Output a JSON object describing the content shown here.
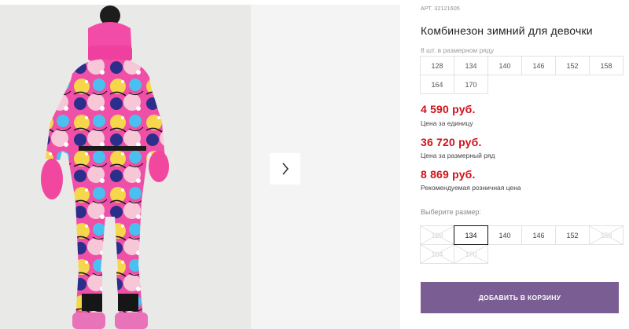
{
  "gallery": {
    "next_icon": "chevron-right-icon"
  },
  "product": {
    "article_label": "АРТ.",
    "article_number": "32121605",
    "title": "Комбинезон зимний для девочки",
    "sizes_note": "8 шт. в размерном ряду",
    "size_range": [
      "128",
      "134",
      "140",
      "146",
      "152",
      "158",
      "164",
      "170"
    ]
  },
  "prices": {
    "unit_price": "4 590 руб.",
    "unit_caption": "Цена за единицу",
    "row_price": "36 720 руб.",
    "row_caption": "Цена за размерный ряд",
    "retail_price": "8 869 руб.",
    "retail_caption": "Рекомендуемая розничная цена"
  },
  "size_picker": {
    "label": "Выберите размер:",
    "options": [
      {
        "label": "128",
        "state": "disabled"
      },
      {
        "label": "134",
        "state": "selected"
      },
      {
        "label": "140",
        "state": "available"
      },
      {
        "label": "146",
        "state": "available"
      },
      {
        "label": "152",
        "state": "available"
      },
      {
        "label": "158",
        "state": "disabled"
      },
      {
        "label": "164",
        "state": "disabled"
      },
      {
        "label": "170",
        "state": "disabled"
      }
    ]
  },
  "cart": {
    "button_label": "ДОБАВИТЬ В КОРЗИНУ",
    "button_color": "#7a5d92"
  },
  "colors": {
    "price_red": "#d0111a"
  }
}
